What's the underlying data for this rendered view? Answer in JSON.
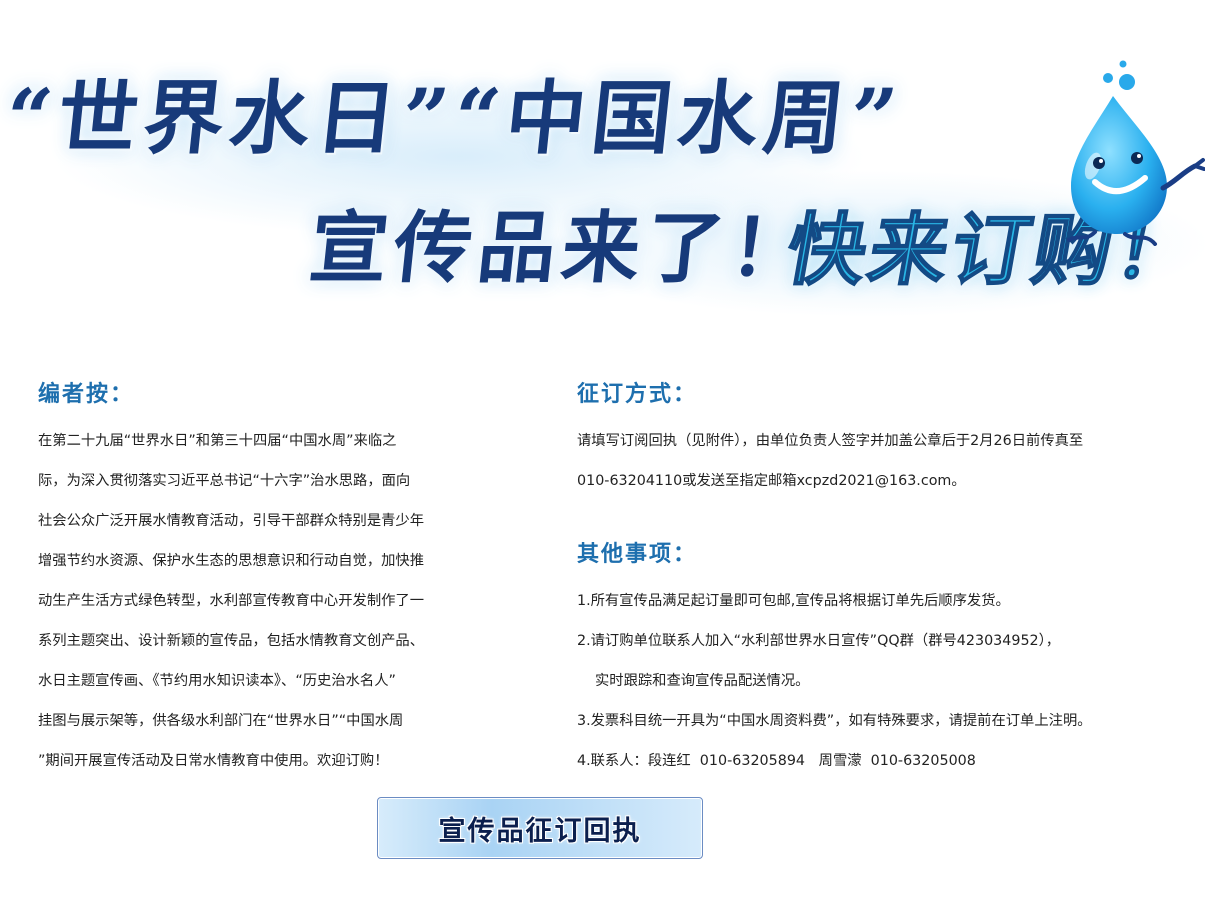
{
  "banner": {
    "line1": "“世界水日”“中国水周”",
    "line2": "宣传品来了！",
    "line3": "快来订购！"
  },
  "editor_note": {
    "heading": "编者按：",
    "lines": [
      "在第二十九届“世界水日”和第三十四届“中国水周”来临之",
      "际，为深入贯彻落实习近平总书记“十六字”治水思路，面向",
      "社会公众广泛开展水情教育活动，引导干部群众特别是青少年",
      "增强节约水资源、保护水生态的思想意识和行动自觉，加快推",
      "动生产生活方式绿色转型，水利部宣传教育中心开发制作了一",
      "系列主题突出、设计新颖的宣传品，包括水情教育文创产品、",
      "水日主题宣传画、《节约用水知识读本》、“历史治水名人”",
      "挂图与展示架等，供各级水利部门在“世界水日”“中国水周",
      "”期间开展宣传活动及日常水情教育中使用。欢迎订购！"
    ]
  },
  "subscription": {
    "heading": "征订方式：",
    "lines": [
      "请填写订阅回执（见附件），由单位负责人签字并加盖公章后于2月26日前传真至",
      "010-63204110或发送至指定邮箱xcpzd2021@163.com。"
    ]
  },
  "other": {
    "heading": "其他事项：",
    "items": [
      "1.所有宣传品满足起订量即可包邮,宣传品将根据订单先后顺序发货。",
      "2.请订购单位联系人加入“水利部世界水日宣传”QQ群（群号423034952），",
      "实时跟踪和查询宣传品配送情况。",
      "3.发票科目统一开具为“中国水周资料费”，如有特殊要求，请提前在订单上注明。",
      "4.联系人：段连红  010-63205894   周雪濛  010-63205008"
    ]
  },
  "receipt_button": {
    "label": "宣传品征订回执"
  },
  "icons": {
    "mascot": "water-drop-mascot-icon"
  },
  "colors": {
    "title_dark_blue": "#173a7a",
    "title_cyan": "#29b7e6",
    "heading_blue": "#1e6fae",
    "button_bg": "#a9d3f4"
  }
}
